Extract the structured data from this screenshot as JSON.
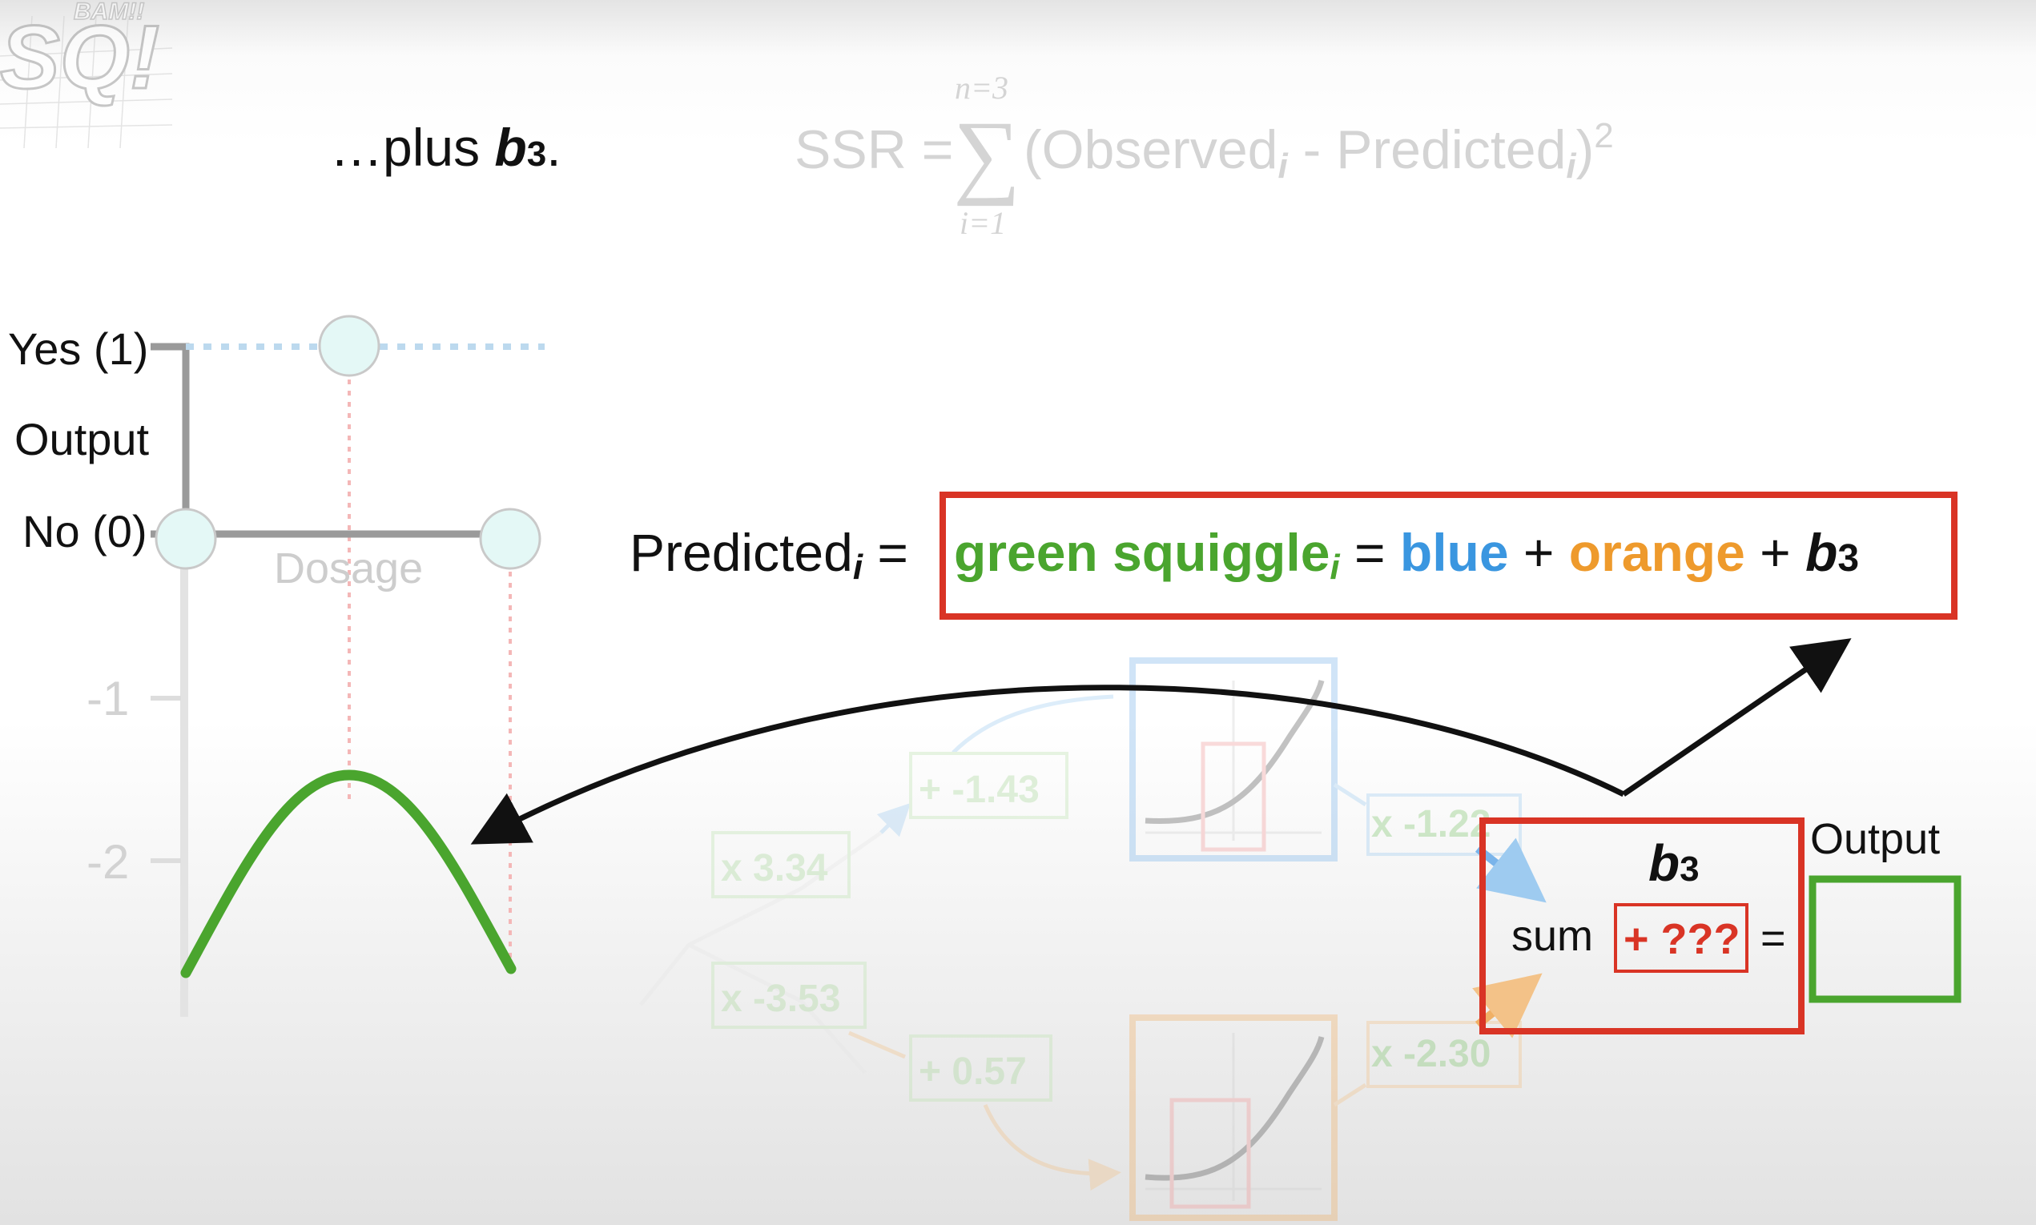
{
  "logo": {
    "text": "SQ!",
    "sub": "BAM!!"
  },
  "caption": {
    "prefix": "…plus ",
    "term": "b",
    "sub": "3",
    "suffix": "."
  },
  "ssr": {
    "lhs": "SSR =",
    "upper": "n=3",
    "lower": "i=1",
    "sigma": "∑",
    "open": "(Observed",
    "i1": "i",
    "minus": " - Predicted",
    "i2": "i",
    "close": ")",
    "power": "2"
  },
  "axis": {
    "yes_label": "Yes (1)",
    "output_label": "Output",
    "no_label": "No (0)",
    "dosage_label": "Dosage",
    "tick_neg1": "-1",
    "tick_neg2": "-2"
  },
  "equation": {
    "predicted": "Predicted",
    "predicted_sub": "i",
    "eq1": " = ",
    "green": "green squiggle",
    "green_sub": "i",
    "eq2": " = ",
    "blue": "blue",
    "plus1": " + ",
    "orange": "orange",
    "plus2": " + ",
    "b": "b",
    "b_sub": "3"
  },
  "network": {
    "w_top_left": "x 3.34",
    "w_bot_left": "x -3.53",
    "bias_top": "+ -1.43",
    "bias_bot": "+ 0.57",
    "w_top_right": "x -1.22",
    "w_bot_right": "x -2.30"
  },
  "sum_box": {
    "b": "b",
    "b_sub": "3",
    "sum_label": "sum",
    "value": "+ ???",
    "equals": "="
  },
  "output_box": {
    "label": "Output"
  },
  "colors": {
    "green": "#4aa52e",
    "blue": "#3a96e0",
    "orange": "#ee9a2c",
    "red": "#d93425",
    "black": "#111111",
    "faded_gray": "#cdcdcd"
  }
}
